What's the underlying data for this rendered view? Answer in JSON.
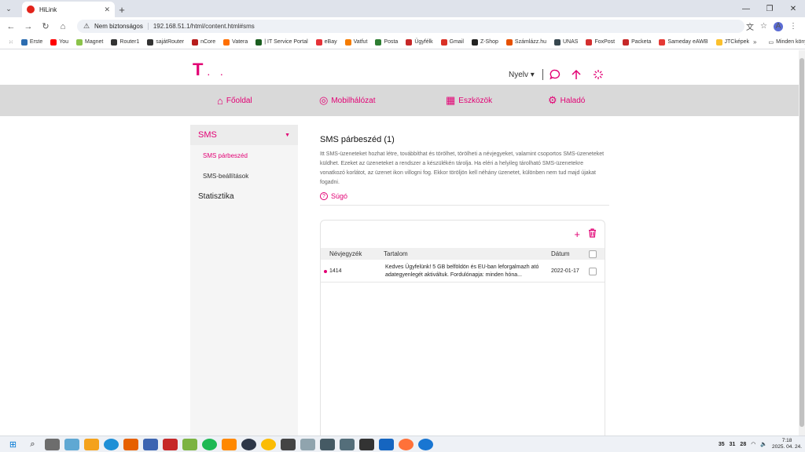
{
  "browser": {
    "tab_title": "HiLink",
    "tab_close": "✕",
    "new_tab": "+",
    "security_label": "Nem biztonságos",
    "url": "192.168.51.1/html/content.html#sms",
    "bookmarks": [
      {
        "label": "Erste",
        "color": "#2b6cb0"
      },
      {
        "label": "You",
        "color": "#ff0000"
      },
      {
        "label": "Magnet",
        "color": "#8bc34a"
      },
      {
        "label": "Router1",
        "color": "#333333"
      },
      {
        "label": "sajátRouter",
        "color": "#333333"
      },
      {
        "label": "nCore",
        "color": "#b71c1c"
      },
      {
        "label": "Vatera",
        "color": "#ff6f00"
      },
      {
        "label": "| IT Service Portal",
        "color": "#1b5e20"
      },
      {
        "label": "eBay",
        "color": "#e53238"
      },
      {
        "label": "Vatfut",
        "color": "#f57c00"
      },
      {
        "label": "Posta",
        "color": "#2e7d32"
      },
      {
        "label": "Ügyfélk",
        "color": "#c62828"
      },
      {
        "label": "Gmail",
        "color": "#d93025"
      },
      {
        "label": "Z-Shop",
        "color": "#222222"
      },
      {
        "label": "Számlázz.hu",
        "color": "#e65100"
      },
      {
        "label": "UNAS",
        "color": "#37474f"
      },
      {
        "label": "FoxPost",
        "color": "#d32f2f"
      },
      {
        "label": "Packeta",
        "color": "#c62828"
      },
      {
        "label": "Sameday eAWB",
        "color": "#e53935"
      },
      {
        "label": "JTCképek",
        "color": "#fbc02d"
      }
    ],
    "bookmarks_more": "»",
    "all_bookmarks": "Minden könyvjelző",
    "profile_initial": "A"
  },
  "header": {
    "logo": "T",
    "logo_dots": "· ·",
    "language": "Nyelv",
    "language_caret": "▾"
  },
  "nav": {
    "items": [
      {
        "label": "Főoldal",
        "icon": "⌂"
      },
      {
        "label": "Mobilhálózat",
        "icon": "◎"
      },
      {
        "label": "Eszközök",
        "icon": "▦"
      },
      {
        "label": "Haladó",
        "icon": "⚙"
      }
    ]
  },
  "sidebar": {
    "sms": "SMS",
    "sms_caret": "▼",
    "sms_dialog": "SMS párbeszéd",
    "sms_settings": "SMS-beállítások",
    "statistics": "Statisztika"
  },
  "content": {
    "title": "SMS párbeszéd (1)",
    "description": "Itt SMS-üzeneteket hozhat létre, továbbíthat és törölhet, törölheti a névjegyeket, valamint csoportos SMS-üzeneteket küldhet. Ezeket az üzeneteket a rendszer a készülékén tárolja. Ha eléri a helyileg tárolható SMS-üzenetekre vonatkozó korlátot, az üzenet ikon villogni fog. Ekkor töröljön kell néhány üzenetet, különben nem tud majd újakat fogadni.",
    "help": "Súgó",
    "help_icon": "?"
  },
  "table": {
    "add_icon": "+",
    "delete_icon": "🗑",
    "headers": {
      "contact": "Névjegyzék",
      "content": "Tartalom",
      "date": "Dátum"
    },
    "rows": [
      {
        "contact": "1414",
        "content": "Kedves Ügyfelünk! 5 GB belföldön és EU-ban leforgalmazh ató adategyenlegét aktiváltuk. Fordulónapja: minden hóna...",
        "date": "2022-01-17"
      }
    ]
  },
  "taskbar": {
    "tray_num_1": "35",
    "tray_num_2": "31",
    "tray_num_3": "28",
    "time": "7:18",
    "date": "2025. 04. 24."
  },
  "colors": {
    "accent": "#e20074",
    "nav_bg": "#d9d9d9"
  }
}
